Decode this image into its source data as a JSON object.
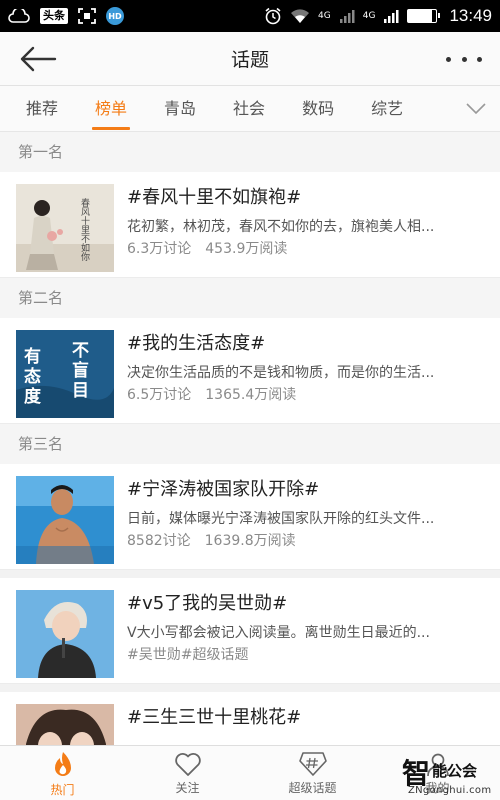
{
  "status_bar": {
    "app_badge": "头条",
    "hd_badge": "HD",
    "net_4g_1": "4G",
    "net_4g_2": "4G",
    "time": "13:49",
    "battery_level": 0.85
  },
  "header": {
    "title": "话题"
  },
  "tabs": [
    {
      "label": "推荐",
      "active": false
    },
    {
      "label": "榜单",
      "active": true
    },
    {
      "label": "青岛",
      "active": false
    },
    {
      "label": "社会",
      "active": false
    },
    {
      "label": "数码",
      "active": false
    },
    {
      "label": "综艺",
      "active": false
    }
  ],
  "ranks": [
    {
      "label": "第一名",
      "title": "#春风十里不如旗袍#",
      "desc": "花初繁，林初茂，春风不如你的去，旗袍美人相...",
      "discussions": "6.3万讨论",
      "reads": "453.9万阅读",
      "thumb_text": "春风十里不如你"
    },
    {
      "label": "第二名",
      "title": "#我的生活态度#",
      "desc": "决定你生活品质的不是钱和物质，而是你的生活...",
      "discussions": "6.5万讨论",
      "reads": "1365.4万阅读",
      "thumb_text": "有态度 不盲目"
    },
    {
      "label": "第三名",
      "title": "#宁泽涛被国家队开除#",
      "desc": "日前，媒体曝光宁泽涛被国家队开除的红头文件...",
      "discussions": "8582讨论",
      "reads": "1639.8万阅读"
    }
  ],
  "more_topics": [
    {
      "title": "#v5了我的吴世勋#",
      "desc": "V大小写都会被记入阅读量。离世勋生日最近的...",
      "tags": "#吴世勋#超级话题"
    },
    {
      "title": "#三生三世十里桃花#"
    }
  ],
  "bottom_nav": [
    {
      "label": "热门",
      "icon": "flame-icon",
      "active": true
    },
    {
      "label": "关注",
      "icon": "heart-icon",
      "active": false
    },
    {
      "label": "超级话题",
      "icon": "hashtag-icon",
      "active": false
    },
    {
      "label": "我的",
      "icon": "user-icon",
      "active": false
    }
  ],
  "watermark": {
    "big": "智",
    "small": "能公会",
    "url": "ZNgonghui.com"
  },
  "colors": {
    "accent": "#f47c16",
    "text": "#222222",
    "muted": "#8a8a8a"
  }
}
